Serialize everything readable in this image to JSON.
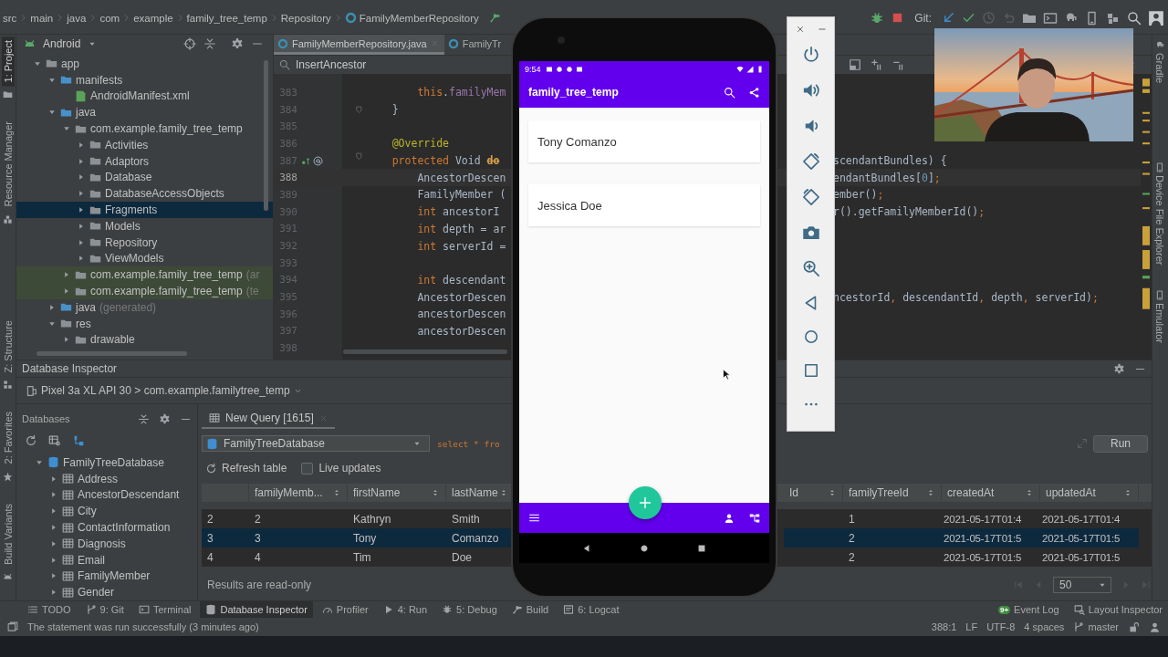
{
  "breadcrumb": [
    "src",
    "main",
    "java",
    "com",
    "example",
    "family_tree_temp",
    "Repository",
    "FamilyMemberRepository"
  ],
  "toolbar": {
    "git_label": "Git:"
  },
  "left_stripe": [
    {
      "label": "1: Project",
      "selected": true
    },
    {
      "label": "Resource Manager",
      "selected": false
    },
    {
      "label": "Z: Structure",
      "selected": false
    },
    {
      "label": "2: Favorites",
      "selected": false
    },
    {
      "label": "Build Variants",
      "selected": false
    }
  ],
  "right_stripe": [
    {
      "label": "Gradle",
      "selected": false
    },
    {
      "label": "Device File Explorer",
      "selected": false
    },
    {
      "label": "Emulator",
      "selected": false
    }
  ],
  "project": {
    "view": "Android",
    "tree": [
      {
        "label": "app",
        "kind": "module",
        "expanded": true,
        "selected": false,
        "children": [
          {
            "label": "manifests",
            "kind": "folder",
            "expanded": true,
            "selected": false,
            "children": [
              {
                "label": "AndroidManifest.xml",
                "kind": "manifest",
                "selected": false
              }
            ]
          },
          {
            "label": "java",
            "kind": "folder",
            "expanded": true,
            "selected": false,
            "children": [
              {
                "label": "com.example.family_tree_temp",
                "kind": "package",
                "expanded": true,
                "selected": false,
                "children": [
                  {
                    "label": "Activities",
                    "kind": "package",
                    "expanded": false,
                    "selected": false
                  },
                  {
                    "label": "Adaptors",
                    "kind": "package",
                    "expanded": false,
                    "selected": false
                  },
                  {
                    "label": "Database",
                    "kind": "package",
                    "expanded": false,
                    "selected": false
                  },
                  {
                    "label": "DatabaseAccessObjects",
                    "kind": "package",
                    "expanded": false,
                    "selected": false
                  },
                  {
                    "label": "Fragments",
                    "kind": "package",
                    "expanded": false,
                    "selected": true
                  },
                  {
                    "label": "Models",
                    "kind": "package",
                    "expanded": false,
                    "selected": false
                  },
                  {
                    "label": "Repository",
                    "kind": "package",
                    "expanded": false,
                    "selected": false
                  },
                  {
                    "label": "ViewModels",
                    "kind": "package",
                    "expanded": false,
                    "selected": false
                  }
                ]
              },
              {
                "label": "com.example.family_tree_temp",
                "suffix": "(ar",
                "kind": "test_package",
                "expanded": false,
                "selected": false
              },
              {
                "label": "com.example.family_tree_temp",
                "suffix": "(te",
                "kind": "test_package",
                "expanded": false,
                "selected": false
              }
            ]
          },
          {
            "label": "java",
            "suffix": "(generated)",
            "kind": "generated",
            "expanded": false,
            "selected": false
          },
          {
            "label": "res",
            "kind": "res",
            "expanded": true,
            "selected": false,
            "children": [
              {
                "label": "drawable",
                "kind": "package",
                "expanded": false,
                "selected": false
              }
            ]
          }
        ]
      }
    ]
  },
  "editor": {
    "tabs": [
      {
        "label": "FamilyMemberRepository.java",
        "selected": true
      },
      {
        "label": "FamilyTr",
        "selected": false
      }
    ],
    "search": {
      "value": "InsertAncestor"
    },
    "lines": [
      {
        "number": "383",
        "kind": "statement",
        "current": false,
        "left": [
          {
            "t": "this",
            "kind": "keyword"
          },
          {
            "t": ".",
            "kind": "plain"
          },
          {
            "t": "familyMem",
            "kind": "field"
          }
        ]
      },
      {
        "number": "384",
        "kind": "member",
        "current": false,
        "left": [
          {
            "t": "}",
            "kind": "plain"
          }
        ],
        "gutter": [
          {
            "kind": "fold"
          }
        ]
      },
      {
        "number": "385",
        "kind": "blank",
        "current": false
      },
      {
        "number": "386",
        "kind": "member",
        "current": false,
        "left": [
          {
            "t": "@Override",
            "kind": "annotation"
          }
        ]
      },
      {
        "number": "387",
        "kind": "member",
        "current": false,
        "left": [
          {
            "t": "protected",
            "kind": "keyword"
          },
          {
            "t": " Void ",
            "kind": "plain"
          },
          {
            "t": "do",
            "kind": "deprecated"
          }
        ],
        "right": [
          {
            "t": "scendantBundles) {",
            "kind": "plain"
          }
        ],
        "gutter": [
          {
            "kind": "override"
          },
          {
            "kind": "at"
          },
          {
            "kind": "fold"
          }
        ]
      },
      {
        "number": "388",
        "kind": "statement",
        "current": true,
        "left": [
          {
            "t": "AncestorDescen",
            "kind": "plain"
          }
        ],
        "right": [
          {
            "t": "endantBundles[",
            "kind": "plain"
          },
          {
            "t": "0",
            "kind": "number"
          },
          {
            "t": "]",
            "kind": "plain"
          },
          {
            "t": ";",
            "kind": "keyword"
          }
        ]
      },
      {
        "number": "389",
        "kind": "statement",
        "current": false,
        "left": [
          {
            "t": "FamilyMember (",
            "kind": "plain"
          }
        ],
        "right": [
          {
            "t": "ember()",
            "kind": "plain"
          },
          {
            "t": ";",
            "kind": "keyword"
          }
        ]
      },
      {
        "number": "390",
        "kind": "statement",
        "current": false,
        "left": [
          {
            "t": "int",
            "kind": "keyword"
          },
          {
            "t": " ancestorI",
            "kind": "plain"
          }
        ],
        "right": [
          {
            "t": "r().getFamilyMemberId()",
            "kind": "plain"
          },
          {
            "t": ";",
            "kind": "keyword"
          }
        ]
      },
      {
        "number": "391",
        "kind": "statement",
        "current": false,
        "left": [
          {
            "t": "int",
            "kind": "keyword"
          },
          {
            "t": " depth = ar",
            "kind": "plain"
          }
        ]
      },
      {
        "number": "392",
        "kind": "statement",
        "current": false,
        "left": [
          {
            "t": "int",
            "kind": "keyword"
          },
          {
            "t": " serverId =",
            "kind": "plain"
          }
        ]
      },
      {
        "number": "393",
        "kind": "blank",
        "current": false
      },
      {
        "number": "394",
        "kind": "statement",
        "current": false,
        "left": [
          {
            "t": "int",
            "kind": "keyword"
          },
          {
            "t": " descendant",
            "kind": "plain"
          }
        ]
      },
      {
        "number": "395",
        "kind": "statement",
        "current": false,
        "left": [
          {
            "t": "AncestorDescen",
            "kind": "plain"
          }
        ],
        "right": [
          {
            "t": "ncestorId",
            "kind": "plain"
          },
          {
            "t": ", ",
            "kind": "keyword"
          },
          {
            "t": "descendantId",
            "kind": "plain"
          },
          {
            "t": ", ",
            "kind": "keyword"
          },
          {
            "t": "depth",
            "kind": "plain"
          },
          {
            "t": ", ",
            "kind": "keyword"
          },
          {
            "t": "serverId)",
            "kind": "plain"
          },
          {
            "t": ";",
            "kind": "keyword"
          }
        ]
      },
      {
        "number": "396",
        "kind": "statement",
        "current": false,
        "left": [
          {
            "t": "ancestorDescen",
            "kind": "plain"
          }
        ]
      },
      {
        "number": "397",
        "kind": "statement",
        "current": false,
        "left": [
          {
            "t": "ancestorDescen",
            "kind": "plain"
          }
        ]
      },
      {
        "number": "398",
        "kind": "blank",
        "current": false
      }
    ]
  },
  "phone": {
    "time": "9:54",
    "title": "family_tree_temp",
    "items": [
      {
        "name": "Tony Comanzo"
      },
      {
        "name": "Jessica Doe"
      }
    ]
  },
  "database_inspector": {
    "title": "Database Inspector",
    "device": "Pixel 3a XL API 30 > com.example.familytree_temp",
    "databases_label": "Databases",
    "tree": [
      {
        "label": "FamilyTreeDatabase",
        "kind": "database",
        "expanded": true,
        "selected": false,
        "children": [
          {
            "label": "Address",
            "kind": "table",
            "expanded": false,
            "selected": false
          },
          {
            "label": "AncestorDescendant",
            "kind": "table",
            "expanded": false,
            "selected": false
          },
          {
            "label": "City",
            "kind": "table",
            "expanded": false,
            "selected": false
          },
          {
            "label": "ContactInformation",
            "kind": "table",
            "expanded": false,
            "selected": false
          },
          {
            "label": "Diagnosis",
            "kind": "table",
            "expanded": false,
            "selected": false
          },
          {
            "label": "Email",
            "kind": "table",
            "expanded": false,
            "selected": false
          },
          {
            "label": "FamilyMember",
            "kind": "table",
            "expanded": false,
            "selected": false
          },
          {
            "label": "Gender",
            "kind": "table",
            "expanded": false,
            "selected": false
          }
        ]
      }
    ],
    "tabs": [
      {
        "label": "New Query [1615]",
        "selected": true
      }
    ],
    "database_select": "FamilyTreeDatabase",
    "query": "select * fro",
    "run_label": "Run",
    "refresh_label": "Refresh table",
    "live_updates": {
      "label": "Live updates",
      "checked": false
    },
    "table": {
      "columns": [
        "familyMemb...",
        "firstName",
        "lastName",
        "Id",
        "familyTreeId",
        "createdAt",
        "updatedAt"
      ],
      "rows": [
        {
          "number": "2",
          "selected": false,
          "cells": [
            "2",
            "Kathryn",
            "Smith",
            null,
            "1",
            "2021-05-17T01:4",
            "2021-05-17T01:4"
          ]
        },
        {
          "number": "3",
          "selected": true,
          "cells": [
            "3",
            "Tony",
            "Comanzo",
            null,
            "2",
            "2021-05-17T01:5",
            "2021-05-17T01:5"
          ]
        },
        {
          "number": "4",
          "selected": false,
          "cells": [
            "4",
            "Tim",
            "Doe",
            null,
            "2",
            "2021-05-17T01:5",
            "2021-05-17T01:5"
          ]
        }
      ]
    },
    "read_only_note": "Results are read-only",
    "page_size": "50"
  },
  "tool_tabs": [
    {
      "label": "TODO",
      "kind": "todo",
      "selected": false
    },
    {
      "label": "9: Git",
      "kind": "git",
      "selected": false
    },
    {
      "label": "Terminal",
      "kind": "terminal",
      "selected": false
    },
    {
      "label": "Database Inspector",
      "kind": "database",
      "selected": true
    },
    {
      "label": "Profiler",
      "kind": "profiler",
      "selected": false
    },
    {
      "label": "4: Run",
      "kind": "run",
      "selected": false
    },
    {
      "label": "5: Debug",
      "kind": "debug",
      "selected": false
    },
    {
      "label": "Build",
      "kind": "build",
      "selected": false
    },
    {
      "label": "6: Logcat",
      "kind": "logcat",
      "selected": false
    }
  ],
  "right_tool_tabs": [
    {
      "label": "Event Log",
      "kind": "event_log",
      "badge": "9+",
      "selected": false
    },
    {
      "label": "Layout Inspector",
      "kind": "layout_inspector",
      "selected": false
    }
  ],
  "status_bar": {
    "message": "The statement was run successfully (3 minutes ago)",
    "position": "388:1",
    "line_ending": "LF",
    "encoding": "UTF-8",
    "indent": "4 spaces",
    "branch": "master"
  }
}
